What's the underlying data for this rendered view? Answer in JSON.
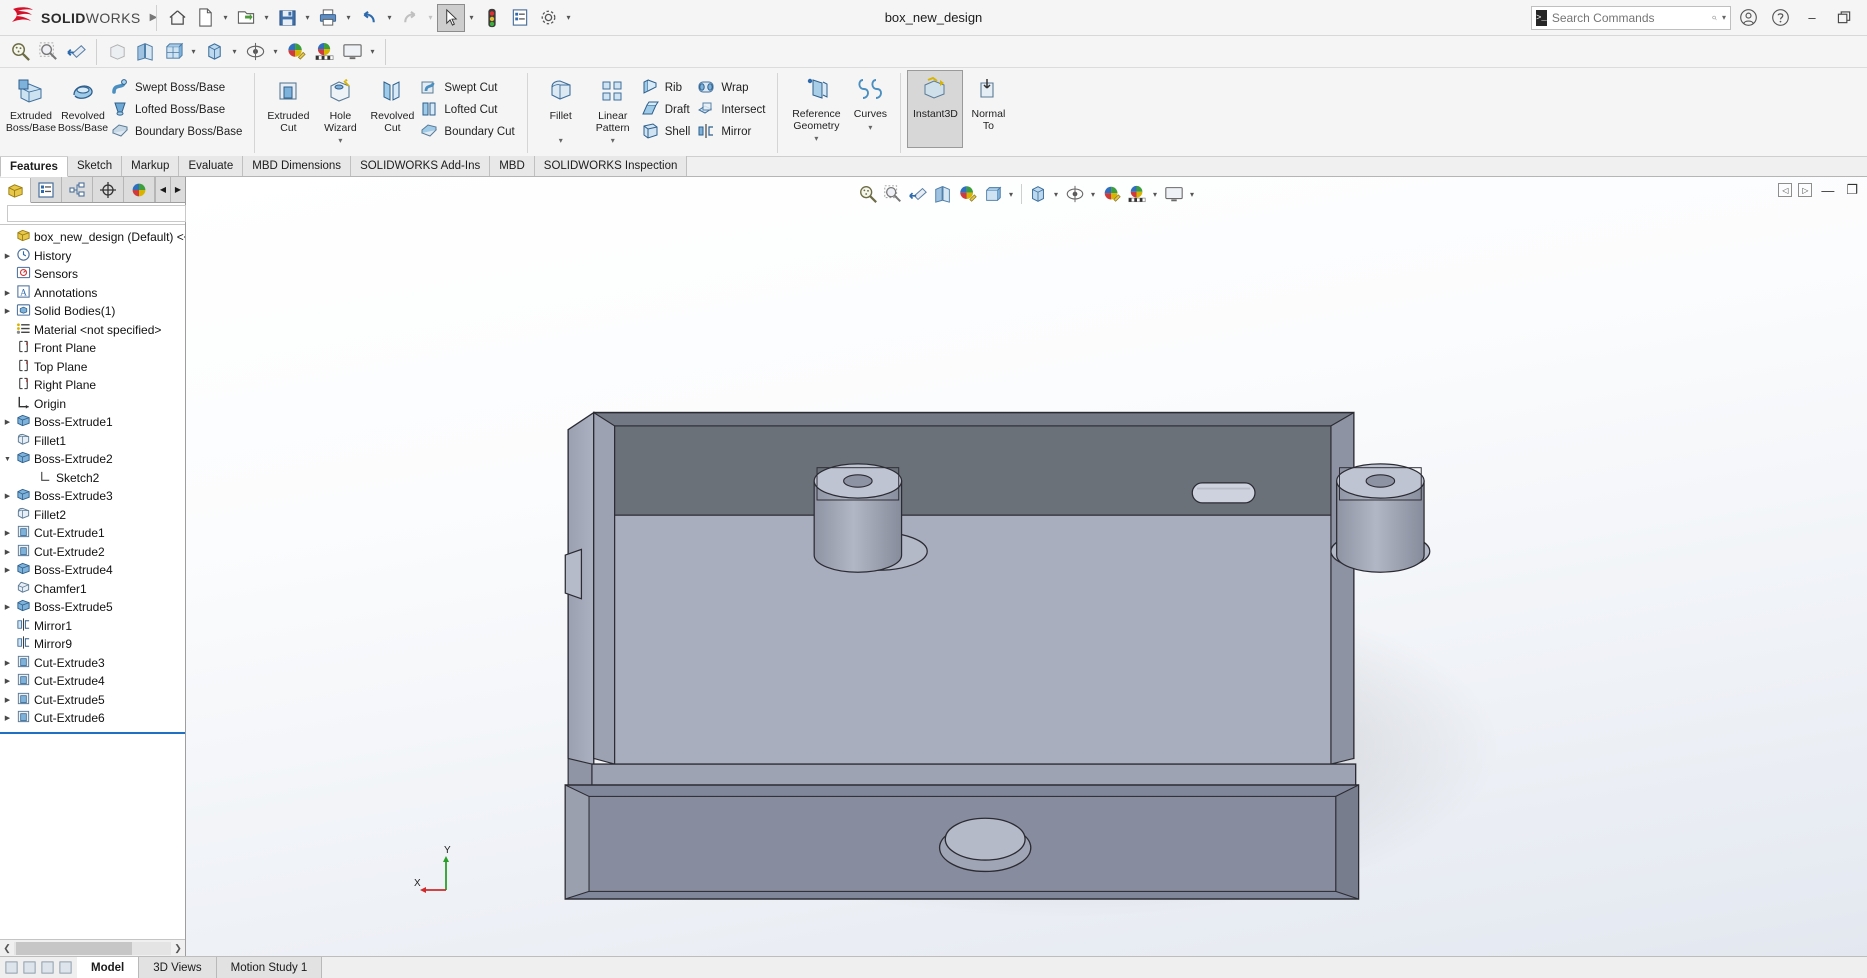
{
  "app": {
    "brand_ds": "ЭS",
    "brand_bold": "SOLID",
    "brand_light": "WORKS",
    "document_title": "box_new_design",
    "accent_red": "#d4112a",
    "accent_blue": "#1f6fc4"
  },
  "search": {
    "placeholder": "Search Commands",
    "value": ""
  },
  "window_controls": {
    "account": "account-icon",
    "help": "help-icon",
    "minimize": "–",
    "restore": "restore-icon"
  },
  "quick_access": [
    {
      "name": "home",
      "icon": "home-icon",
      "caret": false
    },
    {
      "name": "new",
      "icon": "new-document-icon",
      "caret": true
    },
    {
      "name": "open",
      "icon": "open-folder-icon",
      "caret": true
    },
    {
      "name": "save",
      "icon": "save-disk-icon",
      "caret": true
    },
    {
      "name": "print",
      "icon": "print-icon",
      "caret": true
    },
    {
      "name": "undo",
      "icon": "undo-arrow-icon",
      "caret": true
    },
    {
      "name": "redo",
      "icon": "redo-arrow-icon",
      "caret": true
    },
    {
      "name": "select",
      "icon": "cursor-arrow-icon",
      "caret": true,
      "active": true
    },
    {
      "name": "rebuild",
      "icon": "traffic-light-icon",
      "caret": false
    },
    {
      "name": "options-list",
      "icon": "list-properties-icon",
      "caret": false
    },
    {
      "name": "options",
      "icon": "gear-icon",
      "caret": true
    }
  ],
  "view_toolbar": [
    {
      "name": "zoom-to-fit",
      "icon": "zoom-fit-icon",
      "caret": false
    },
    {
      "name": "zoom-to-area",
      "icon": "zoom-area-icon",
      "caret": false
    },
    {
      "name": "previous-view",
      "icon": "previous-view-icon",
      "caret": false
    },
    {
      "name": "section-view",
      "icon": "section-view-icon",
      "caret": false
    },
    {
      "name": "view-orientation",
      "icon": "view-orientation-icon",
      "caret": false
    },
    {
      "name": "display-style",
      "icon": "display-style-icon",
      "caret": true
    },
    {
      "name": "hide-show-items",
      "icon": "hide-show-icon",
      "caret": true
    },
    {
      "name": "edit-appearance",
      "icon": "appearance-icon",
      "caret": false
    },
    {
      "name": "apply-scene",
      "icon": "scene-icon",
      "caret": true
    },
    {
      "name": "view-settings",
      "icon": "monitor-icon",
      "caret": true
    }
  ],
  "ribbon": {
    "groups": [
      {
        "name": "boss-base",
        "big": [
          {
            "label": "Extruded\nBoss/Base",
            "icon": "extruded-boss-icon"
          },
          {
            "label": "Revolved\nBoss/Base",
            "icon": "revolved-boss-icon"
          }
        ],
        "small": [
          {
            "label": "Swept Boss/Base",
            "icon": "swept-boss-icon"
          },
          {
            "label": "Lofted Boss/Base",
            "icon": "lofted-boss-icon"
          },
          {
            "label": "Boundary Boss/Base",
            "icon": "boundary-boss-icon"
          }
        ]
      },
      {
        "name": "cut",
        "big": [
          {
            "label": "Extruded\nCut",
            "icon": "extruded-cut-icon"
          },
          {
            "label": "Hole\nWizard",
            "icon": "hole-wizard-icon",
            "caret": true
          },
          {
            "label": "Revolved\nCut",
            "icon": "revolved-cut-icon"
          }
        ],
        "small": [
          {
            "label": "Swept Cut",
            "icon": "swept-cut-icon"
          },
          {
            "label": "Lofted Cut",
            "icon": "lofted-cut-icon"
          },
          {
            "label": "Boundary Cut",
            "icon": "boundary-cut-icon"
          }
        ]
      },
      {
        "name": "features",
        "big": [
          {
            "label": "Fillet",
            "icon": "fillet-icon",
            "caret": true
          },
          {
            "label": "Linear\nPattern",
            "icon": "linear-pattern-icon",
            "caret": true
          }
        ],
        "small": [
          {
            "label": "Rib",
            "icon": "rib-icon"
          },
          {
            "label": "Draft",
            "icon": "draft-icon"
          },
          {
            "label": "Shell",
            "icon": "shell-icon"
          }
        ],
        "small2": [
          {
            "label": "Wrap",
            "icon": "wrap-icon"
          },
          {
            "label": "Intersect",
            "icon": "intersect-icon"
          },
          {
            "label": "Mirror",
            "icon": "mirror-icon"
          }
        ]
      },
      {
        "name": "reference",
        "big": [
          {
            "label": "Reference\nGeometry",
            "icon": "reference-geometry-icon",
            "caret": true
          },
          {
            "label": "Curves",
            "icon": "curves-icon",
            "caret": true
          }
        ]
      },
      {
        "name": "instant3d",
        "big": [
          {
            "label": "Instant3D",
            "icon": "instant3d-icon",
            "active": true
          },
          {
            "label": "Normal\nTo",
            "icon": "normal-to-icon"
          }
        ]
      }
    ]
  },
  "command_tabs": [
    {
      "label": "Features",
      "selected": true
    },
    {
      "label": "Sketch",
      "selected": false
    },
    {
      "label": "Markup",
      "selected": false
    },
    {
      "label": "Evaluate",
      "selected": false
    },
    {
      "label": "MBD Dimensions",
      "selected": false
    },
    {
      "label": "SOLIDWORKS Add-Ins",
      "selected": false
    },
    {
      "label": "MBD",
      "selected": false
    },
    {
      "label": "SOLIDWORKS Inspection",
      "selected": false
    }
  ],
  "panel": {
    "tabs": [
      {
        "name": "feature-manager",
        "icon": "feature-tree-icon",
        "selected": true
      },
      {
        "name": "property-manager",
        "icon": "property-manager-icon",
        "selected": false
      },
      {
        "name": "configuration-manager",
        "icon": "configuration-icon",
        "selected": false
      },
      {
        "name": "dimxpert-manager",
        "icon": "dimxpert-icon",
        "selected": false
      },
      {
        "name": "display-manager",
        "icon": "display-manager-icon",
        "selected": false
      }
    ],
    "filter_placeholder": ""
  },
  "tree": {
    "root": {
      "label": "box_new_design (Default) <<Default>",
      "icon": "part-icon"
    },
    "items": [
      {
        "label": "History",
        "icon": "history-icon",
        "expandable": true,
        "indent": 0
      },
      {
        "label": "Sensors",
        "icon": "sensors-icon",
        "expandable": false,
        "indent": 0
      },
      {
        "label": "Annotations",
        "icon": "annotations-icon",
        "expandable": true,
        "indent": 0
      },
      {
        "label": "Solid Bodies(1)",
        "icon": "solid-bodies-icon",
        "expandable": true,
        "indent": 0
      },
      {
        "label": "Material <not specified>",
        "icon": "material-icon",
        "expandable": false,
        "indent": 0
      },
      {
        "label": "Front Plane",
        "icon": "plane-icon",
        "expandable": false,
        "indent": 0
      },
      {
        "label": "Top Plane",
        "icon": "plane-icon",
        "expandable": false,
        "indent": 0
      },
      {
        "label": "Right Plane",
        "icon": "plane-icon",
        "expandable": false,
        "indent": 0
      },
      {
        "label": "Origin",
        "icon": "origin-icon",
        "expandable": false,
        "indent": 0
      },
      {
        "label": "Boss-Extrude1",
        "icon": "boss-extrude-icon",
        "expandable": true,
        "indent": 0
      },
      {
        "label": "Fillet1",
        "icon": "fillet-feature-icon",
        "expandable": false,
        "indent": 0
      },
      {
        "label": "Boss-Extrude2",
        "icon": "boss-extrude-icon",
        "expandable": true,
        "expanded": true,
        "indent": 0
      },
      {
        "label": "Sketch2",
        "icon": "sketch-icon",
        "expandable": false,
        "indent": 1
      },
      {
        "label": "Boss-Extrude3",
        "icon": "boss-extrude-icon",
        "expandable": true,
        "indent": 0
      },
      {
        "label": "Fillet2",
        "icon": "fillet-feature-icon",
        "expandable": false,
        "indent": 0
      },
      {
        "label": "Cut-Extrude1",
        "icon": "cut-extrude-icon",
        "expandable": true,
        "indent": 0
      },
      {
        "label": "Cut-Extrude2",
        "icon": "cut-extrude-icon",
        "expandable": true,
        "indent": 0
      },
      {
        "label": "Boss-Extrude4",
        "icon": "boss-extrude-icon",
        "expandable": true,
        "indent": 0
      },
      {
        "label": "Chamfer1",
        "icon": "chamfer-icon",
        "expandable": false,
        "indent": 0
      },
      {
        "label": "Boss-Extrude5",
        "icon": "boss-extrude-icon",
        "expandable": true,
        "indent": 0
      },
      {
        "label": "Mirror1",
        "icon": "mirror-feature-icon",
        "expandable": false,
        "indent": 0
      },
      {
        "label": "Mirror9",
        "icon": "mirror-feature-icon",
        "expandable": false,
        "indent": 0
      },
      {
        "label": "Cut-Extrude3",
        "icon": "cut-extrude-icon",
        "expandable": true,
        "indent": 0
      },
      {
        "label": "Cut-Extrude4",
        "icon": "cut-extrude-icon",
        "expandable": true,
        "indent": 0
      },
      {
        "label": "Cut-Extrude5",
        "icon": "cut-extrude-icon",
        "expandable": true,
        "indent": 0
      },
      {
        "label": "Cut-Extrude6",
        "icon": "cut-extrude-icon",
        "expandable": true,
        "indent": 0
      }
    ]
  },
  "triad": {
    "x_label": "X",
    "y_label": "Y"
  },
  "status_tabs": [
    {
      "label": "Model",
      "selected": true
    },
    {
      "label": "3D Views",
      "selected": false
    },
    {
      "label": "Motion Study 1",
      "selected": false
    }
  ],
  "model": {
    "face_top_dark": "#6e7480",
    "face_front_light": "#a7abbd",
    "face_side": "#8f95a4",
    "edge_color": "#2b2b33",
    "bosses": 2,
    "slot_count": 1,
    "bottom_boss": 1
  }
}
